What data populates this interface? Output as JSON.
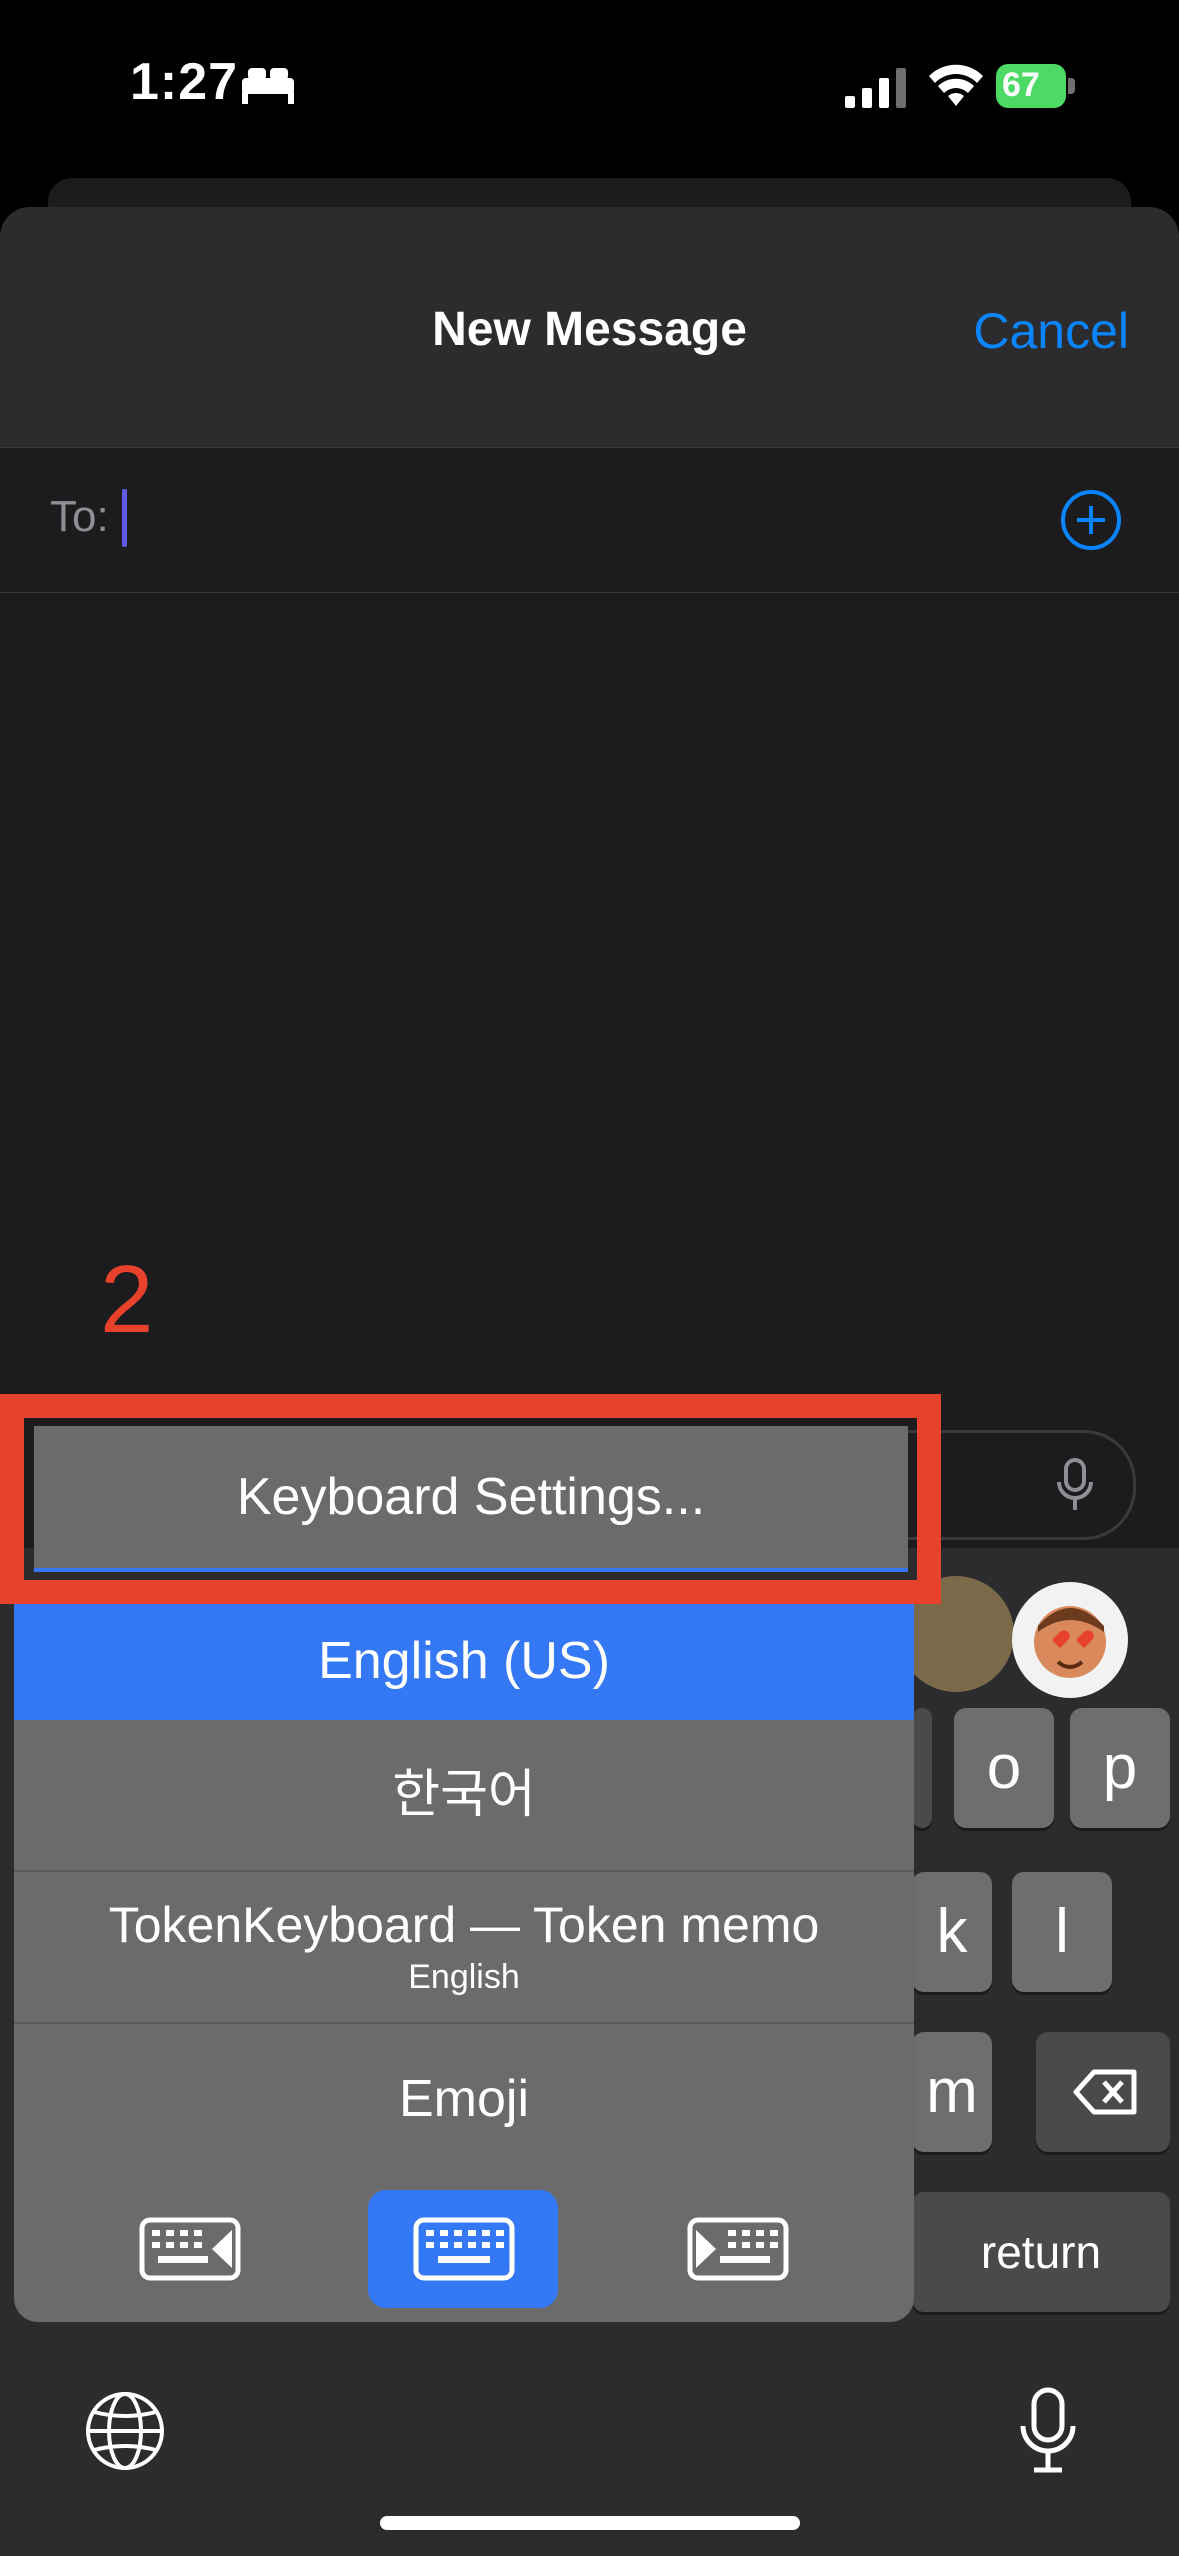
{
  "status_bar": {
    "time": "1:27",
    "battery": "67"
  },
  "sheet": {
    "title": "New Message",
    "cancel_label": "Cancel",
    "to_label": "To:"
  },
  "annotation": {
    "step": "2"
  },
  "keyboard_menu": {
    "settings_label": "Keyboard Settings...",
    "items": [
      {
        "label": "English (US)",
        "selected": true
      },
      {
        "label": "한국어"
      },
      {
        "label": "TokenKeyboard — Token memo",
        "sublabel": "English"
      },
      {
        "label": "Emoji"
      }
    ]
  },
  "keyboard": {
    "keys_row1": [
      "o",
      "p"
    ],
    "keys_row2": [
      "k",
      "l"
    ],
    "keys_row3": [
      "m"
    ],
    "return_label": "return"
  },
  "colors": {
    "accent": "#0a84ff",
    "annotation_red": "#e8412c",
    "selected_blue": "#3478f6"
  }
}
